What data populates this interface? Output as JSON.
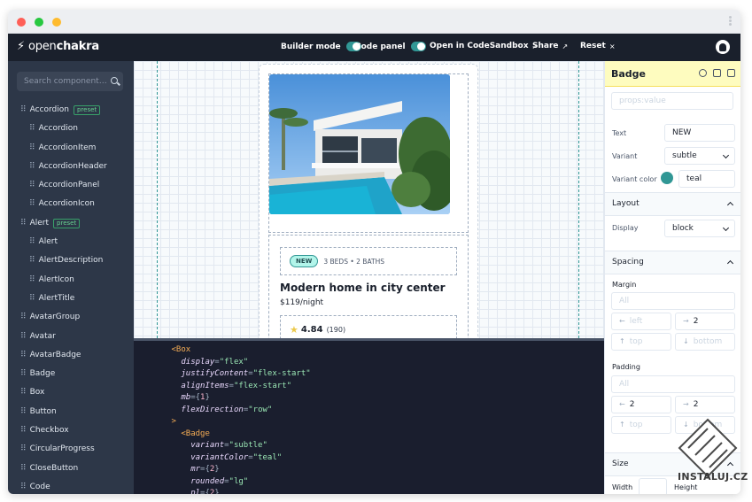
{
  "header": {
    "logo_open": "open",
    "logo_chakra": "chakra",
    "builder_mode": "Builder mode",
    "code_panel": "Code panel",
    "open_codesandbox": "Open in CodeSandbox",
    "share": "Share",
    "reset": "Reset",
    "reset_x": "×"
  },
  "sidebar": {
    "search_placeholder": "Search component…",
    "items": [
      {
        "label": "Accordion",
        "level": 0,
        "preset": "preset"
      },
      {
        "label": "Accordion",
        "level": 1
      },
      {
        "label": "AccordionItem",
        "level": 1
      },
      {
        "label": "AccordionHeader",
        "level": 1
      },
      {
        "label": "AccordionPanel",
        "level": 1
      },
      {
        "label": "AccordionIcon",
        "level": 1
      },
      {
        "label": "Alert",
        "level": 0,
        "preset": "preset"
      },
      {
        "label": "Alert",
        "level": 1
      },
      {
        "label": "AlertDescription",
        "level": 1
      },
      {
        "label": "AlertIcon",
        "level": 1
      },
      {
        "label": "AlertTitle",
        "level": 1
      },
      {
        "label": "AvatarGroup",
        "level": 0
      },
      {
        "label": "Avatar",
        "level": 0
      },
      {
        "label": "AvatarBadge",
        "level": 0
      },
      {
        "label": "Badge",
        "level": 0
      },
      {
        "label": "Box",
        "level": 0
      },
      {
        "label": "Button",
        "level": 0
      },
      {
        "label": "Checkbox",
        "level": 0
      },
      {
        "label": "CircularProgress",
        "level": 0
      },
      {
        "label": "CloseButton",
        "level": 0
      },
      {
        "label": "Code",
        "level": 0
      }
    ]
  },
  "card": {
    "badge": "NEW",
    "beds": "3 BEDS • 2 BATHS",
    "title": "Modern home in city center",
    "price": "$119/night",
    "rating": "4.84",
    "reviews": "(190)"
  },
  "code": {
    "lines": [
      {
        "indent": 6,
        "parts": [
          [
            "tag",
            "<Box"
          ]
        ]
      },
      {
        "indent": 8,
        "parts": [
          [
            "attr",
            "display"
          ],
          [
            "punct",
            "="
          ],
          [
            "str",
            "\"flex\""
          ]
        ]
      },
      {
        "indent": 8,
        "parts": [
          [
            "attr",
            "justifyContent"
          ],
          [
            "punct",
            "="
          ],
          [
            "str",
            "\"flex-start\""
          ]
        ]
      },
      {
        "indent": 8,
        "parts": [
          [
            "attr",
            "alignItems"
          ],
          [
            "punct",
            "="
          ],
          [
            "str",
            "\"flex-start\""
          ]
        ]
      },
      {
        "indent": 8,
        "parts": [
          [
            "attr",
            "mb"
          ],
          [
            "punct",
            "={"
          ],
          [
            "num",
            "1"
          ],
          [
            "punct",
            "}"
          ]
        ]
      },
      {
        "indent": 8,
        "parts": [
          [
            "attr",
            "flexDirection"
          ],
          [
            "punct",
            "="
          ],
          [
            "str",
            "\"row\""
          ]
        ]
      },
      {
        "indent": 6,
        "parts": [
          [
            "tag",
            ">"
          ]
        ]
      },
      {
        "indent": 8,
        "parts": [
          [
            "tag",
            "<Badge"
          ]
        ]
      },
      {
        "indent": 10,
        "parts": [
          [
            "attr",
            "variant"
          ],
          [
            "punct",
            "="
          ],
          [
            "str",
            "\"subtle\""
          ]
        ]
      },
      {
        "indent": 10,
        "parts": [
          [
            "attr",
            "variantColor"
          ],
          [
            "punct",
            "="
          ],
          [
            "str",
            "\"teal\""
          ]
        ]
      },
      {
        "indent": 10,
        "parts": [
          [
            "attr",
            "mr"
          ],
          [
            "punct",
            "={"
          ],
          [
            "num",
            "2"
          ],
          [
            "punct",
            "}"
          ]
        ]
      },
      {
        "indent": 10,
        "parts": [
          [
            "attr",
            "rounded"
          ],
          [
            "punct",
            "="
          ],
          [
            "str",
            "\"lg\""
          ]
        ]
      },
      {
        "indent": 10,
        "parts": [
          [
            "attr",
            "pl"
          ],
          [
            "punct",
            "={"
          ],
          [
            "num",
            "2"
          ],
          [
            "punct",
            "}"
          ]
        ]
      }
    ]
  },
  "panel": {
    "title": "Badge",
    "props_placeholder": "props:value",
    "text_label": "Text",
    "text_value": "NEW",
    "variant_label": "Variant",
    "variant_value": "subtle",
    "variant_color_label": "Variant color",
    "variant_color_value": "teal",
    "variant_color_hex": "#319795",
    "layout_label": "Layout",
    "display_label": "Display",
    "display_value": "block",
    "spacing_label": "Spacing",
    "margin_label": "Margin",
    "all_placeholder": "All",
    "left_placeholder": "left",
    "right_value": "2",
    "top_placeholder": "top",
    "bottom_placeholder": "bottom",
    "padding_label": "Padding",
    "pad_left_value": "2",
    "pad_right_value": "2",
    "size_label": "Size",
    "width_label": "Width",
    "height_label": "Height"
  },
  "watermark": {
    "text": "INSTALUJ.CZ"
  },
  "colors": {
    "accent": "#319795",
    "header_bg": "#1a202c",
    "sidebar_bg": "#2d3748",
    "panel_head_bg": "#fefcbf"
  }
}
